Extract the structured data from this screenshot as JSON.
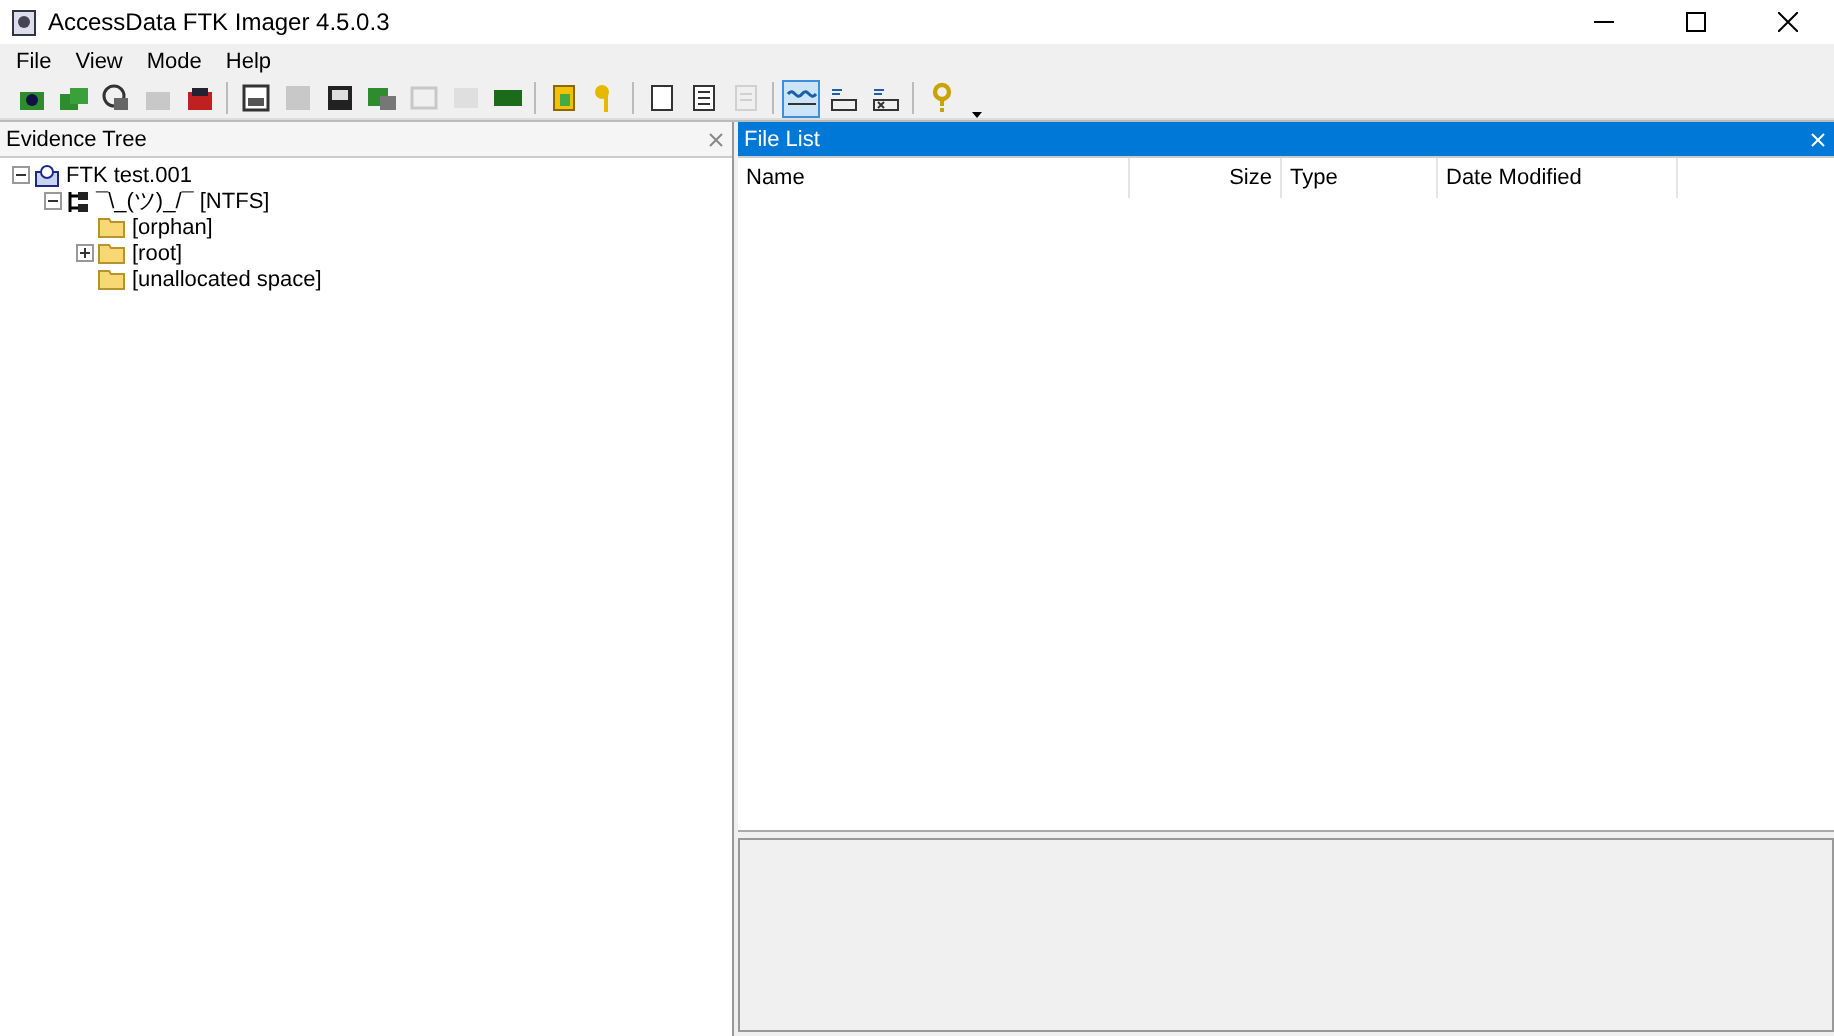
{
  "window": {
    "title": "AccessData FTK Imager 4.5.0.3"
  },
  "menu": [
    "File",
    "View",
    "Mode",
    "Help"
  ],
  "toolbar": [
    {
      "kind": "button",
      "disabled": false,
      "selected": false
    },
    {
      "kind": "button",
      "disabled": false,
      "selected": false
    },
    {
      "kind": "button",
      "disabled": false,
      "selected": false
    },
    {
      "kind": "button",
      "disabled": true,
      "selected": false
    },
    {
      "kind": "button",
      "disabled": false,
      "selected": false
    },
    {
      "kind": "separator"
    },
    {
      "kind": "button",
      "disabled": false,
      "selected": false
    },
    {
      "kind": "button",
      "disabled": true,
      "selected": false
    },
    {
      "kind": "button",
      "disabled": false,
      "selected": false
    },
    {
      "kind": "button",
      "disabled": false,
      "selected": false
    },
    {
      "kind": "button",
      "disabled": true,
      "selected": false
    },
    {
      "kind": "button",
      "disabled": true,
      "selected": false
    },
    {
      "kind": "button",
      "disabled": false,
      "selected": false
    },
    {
      "kind": "separator"
    },
    {
      "kind": "button",
      "disabled": false,
      "selected": false
    },
    {
      "kind": "button",
      "disabled": false,
      "selected": false
    },
    {
      "kind": "separator"
    },
    {
      "kind": "button",
      "disabled": false,
      "selected": false
    },
    {
      "kind": "button",
      "disabled": false,
      "selected": false
    },
    {
      "kind": "button",
      "disabled": true,
      "selected": false
    },
    {
      "kind": "separator"
    },
    {
      "kind": "button",
      "disabled": false,
      "selected": true
    },
    {
      "kind": "button",
      "disabled": false,
      "selected": false
    },
    {
      "kind": "button",
      "disabled": false,
      "selected": false
    },
    {
      "kind": "separator"
    },
    {
      "kind": "button",
      "disabled": false,
      "selected": false
    },
    {
      "kind": "dropdown"
    }
  ],
  "evidence_tree": {
    "title": "Evidence Tree",
    "active": false,
    "items": [
      {
        "label": "FTK test.001",
        "kind": "image",
        "expanded": true,
        "children": [
          {
            "label": "¯\\_(ツ)_/¯ [NTFS]",
            "kind": "partition",
            "expanded": true,
            "children": [
              {
                "label": "[orphan]",
                "kind": "folder"
              },
              {
                "label": "[root]",
                "kind": "folder",
                "expanded": false
              },
              {
                "label": "[unallocated space]",
                "kind": "folder"
              }
            ]
          }
        ]
      }
    ]
  },
  "file_list": {
    "title": "File List",
    "active": true,
    "columns": [
      {
        "label": "Name",
        "kind": "text"
      },
      {
        "label": "Size",
        "kind": "number"
      },
      {
        "label": "Type",
        "kind": "text"
      },
      {
        "label": "Date Modified",
        "kind": "text"
      }
    ]
  }
}
